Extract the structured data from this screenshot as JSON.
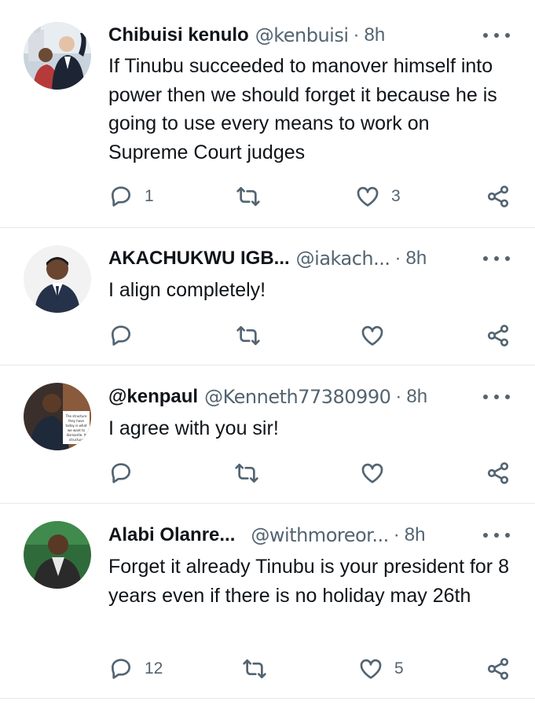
{
  "tweets": [
    {
      "name": "Chibuisi kenulo",
      "handle": "@kenbuisi",
      "time": "8h",
      "text": "If Tinubu succeeded to manover himself into power then we should forget it because he is going to use every means to work on Supreme Court judges",
      "replies": "1",
      "retweets": "",
      "likes": "3"
    },
    {
      "name": "AKACHUKWU IGB...",
      "handle": "@iakach...",
      "time": "8h",
      "text": "I align completely!",
      "replies": "",
      "retweets": "",
      "likes": ""
    },
    {
      "name": "@kenpaul",
      "handle": "@Kenneth77380990",
      "time": "8h",
      "text": "I agree with you sir!",
      "replies": "",
      "retweets": "",
      "likes": "",
      "avatar_caption": "The structure they have today is what we want to dismantle. It's a structure of criminals"
    },
    {
      "name": "Alabi Olanre...",
      "handle": "@withmoreor...",
      "time": "8h",
      "text": "Forget it already Tinubu is your president for 8 years even if there is no holiday may 26th",
      "replies": "12",
      "retweets": "",
      "likes": "5"
    }
  ],
  "separator": "·",
  "icons": {
    "reply": "reply-icon",
    "retweet": "retweet-icon",
    "like": "heart-icon",
    "share": "share-icon",
    "more": "more-icon"
  },
  "colors": {
    "text": "#0f1419",
    "secondary": "#536471",
    "divider": "#e7e9ea"
  }
}
